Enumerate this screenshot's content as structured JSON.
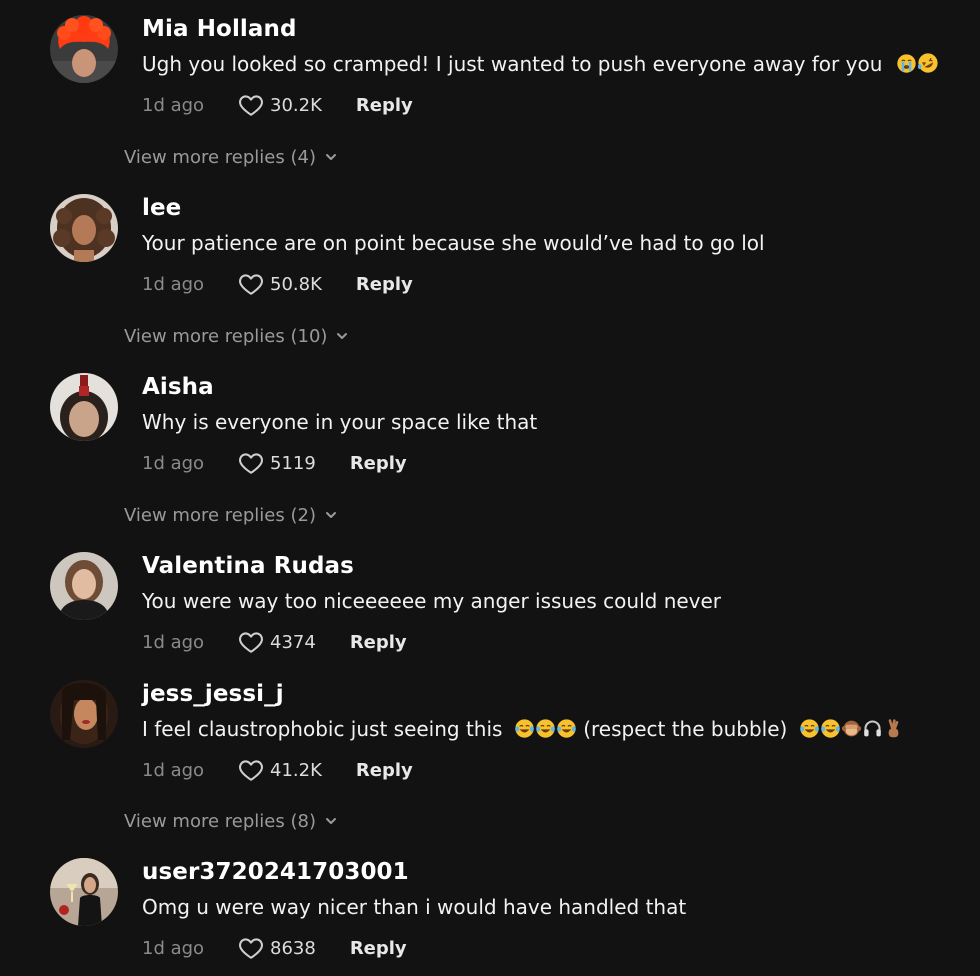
{
  "colors": {
    "background": "#121212",
    "username": "#ffffff",
    "text": "#f2f2f2",
    "muted": "#8a8a8a"
  },
  "comments": [
    {
      "username": "Mia Holland",
      "text": "Ugh you looked so cramped! I just wanted to push everyone away for you",
      "emojis": [
        "loudly-crying-face",
        "rolling-on-floor-laughing"
      ],
      "time": "1d ago",
      "likes": "30.2K",
      "reply_label": "Reply",
      "view_more": "View more replies (4)"
    },
    {
      "username": "lee",
      "text": "Your patience are on point because she would’ve had to go lol",
      "time": "1d ago",
      "likes": "50.8K",
      "reply_label": "Reply",
      "view_more": "View more replies (10)"
    },
    {
      "username": "Aisha",
      "text": "Why is everyone in your space like that",
      "time": "1d ago",
      "likes": "5119",
      "reply_label": "Reply",
      "view_more": "View more replies (2)"
    },
    {
      "username": "Valentina Rudas",
      "text": "You were way too niceeeeee my anger issues could never",
      "time": "1d ago",
      "likes": "4374",
      "reply_label": "Reply"
    },
    {
      "username": "jess_jessi_j",
      "text_a": "I feel claustrophobic just seeing this",
      "text_b": "(respect the bubble)",
      "emojis_a": [
        "face-with-tears-of-joy",
        "face-with-tears-of-joy",
        "face-with-tears-of-joy"
      ],
      "emojis_b": [
        "face-with-tears-of-joy",
        "face-with-tears-of-joy",
        "see-no-evil-monkey",
        "headphones",
        "victory-hand"
      ],
      "time": "1d ago",
      "likes": "41.2K",
      "reply_label": "Reply",
      "view_more": "View more replies (8)"
    },
    {
      "username": "user3720241703001",
      "text": "Omg u were way nicer than i would have handled that",
      "time": "1d ago",
      "likes": "8638",
      "reply_label": "Reply"
    }
  ]
}
